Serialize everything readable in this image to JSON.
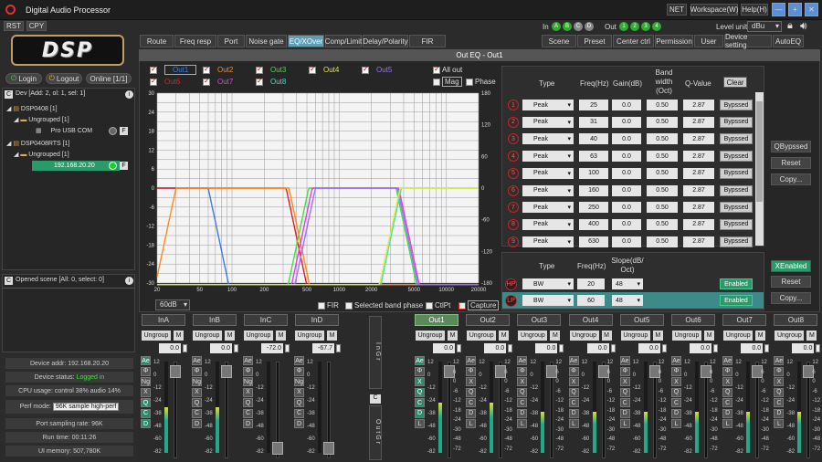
{
  "app": {
    "title": "Digital Audio Processor"
  },
  "window_buttons": {
    "net": "NET",
    "workspace": "Workspace(W)",
    "help": "Help(H)",
    "min": "—",
    "max": "+",
    "close": "✕"
  },
  "toolbar": {
    "rst": "RST",
    "cpy": "CPY",
    "in_label": "In",
    "in_badges": [
      "A",
      "B",
      "C",
      "D"
    ],
    "out_label": "Out",
    "out_badges": [
      "1",
      "2",
      "3",
      "4"
    ],
    "level_unit_label": "Level unit",
    "level_unit_value": "dBu"
  },
  "logo": {
    "text": "DSP"
  },
  "tabs": [
    "Route",
    "Freq resp",
    "Port",
    "Noise gate",
    "EQ/XOver",
    "Comp/Limit",
    "Delay/Polarity",
    "FIR"
  ],
  "right_tabs": [
    "Scene",
    "Preset",
    "Center ctrl",
    "Permission",
    "User",
    "Device setting",
    "AutoEQ"
  ],
  "left": {
    "login": "Login",
    "logout": "Logout",
    "online": "Online [1/1]",
    "dev_header": "Dev [Add: 2, ol: 1, sel: 1]",
    "tree": {
      "dsp1": "DSP0408 [1]",
      "ungrouped1": "Ungrouped [1]",
      "usb": "Pro USB COM",
      "dsp2": "DSP0408RTS [1]",
      "ungrouped2": "Ungrouped [1]",
      "ip": "192.168.20.20"
    },
    "scene_header": "Opened scene [All: 0, select: 0]",
    "f_label": "F",
    "c_label": "C",
    "status": {
      "device_addr": "Device addr: 192.168.20.20",
      "device_status_label": "Device status:",
      "device_status_value": "Logged in",
      "cpu": "CPU usage: control 38% audio 14%",
      "perf_label": "Perf mode:",
      "perf_value": "96K sample high-perf",
      "port_rate": "Port sampling rate: 96K",
      "run_time": "Run time: 00:11:26",
      "ui_memory": "UI memory: 507,780K"
    }
  },
  "eq": {
    "title": "Out EQ - Out1",
    "legend": [
      {
        "label": "Out1",
        "color": "#3c7de0",
        "checked": true
      },
      {
        "label": "Out2",
        "color": "#ff8c1a",
        "checked": true
      },
      {
        "label": "Out3",
        "color": "#44dd44",
        "checked": true
      },
      {
        "label": "Out4",
        "color": "#e8e832",
        "checked": true
      },
      {
        "label": "Out5",
        "color": "#9a70ff",
        "checked": true
      },
      {
        "label": "Out6",
        "color": "#e02020",
        "checked": true
      },
      {
        "label": "Out7",
        "color": "#e040e0",
        "checked": true
      },
      {
        "label": "Out8",
        "color": "#40e0c0",
        "checked": true
      }
    ],
    "all_out": "All out",
    "mag": "Mag",
    "phase": "Phase",
    "y_left": [
      "30",
      "24",
      "18",
      "12",
      "6",
      "0",
      "-6",
      "-12",
      "-18",
      "-24",
      "-30"
    ],
    "y_right": [
      "180",
      "120",
      "60",
      "0",
      "-60",
      "-120",
      "-180"
    ],
    "x_ticks": [
      "20",
      "50",
      "100",
      "200",
      "500",
      "1000",
      "2000",
      "5000",
      "10000",
      "20000"
    ],
    "range_select": "60dB",
    "bottom_opts": {
      "fir": "FIR",
      "selected_band_phase": "Selected band phase",
      "ctlpt": "CtlPt",
      "capture": "Capture"
    },
    "table_headers": {
      "type": "Type",
      "freq": "Freq(Hz)",
      "gain": "Gain(dB)",
      "bw": "Band width (Oct)",
      "q": "Q-Value",
      "clear": "Clear"
    },
    "bands": [
      {
        "n": "1",
        "type": "Peak",
        "freq": "25",
        "gain": "0.0",
        "bw": "0.50",
        "q": "2.87",
        "state": "Bypssed"
      },
      {
        "n": "2",
        "type": "Peak",
        "freq": "31",
        "gain": "0.0",
        "bw": "0.50",
        "q": "2.87",
        "state": "Bypssed"
      },
      {
        "n": "3",
        "type": "Peak",
        "freq": "40",
        "gain": "0.0",
        "bw": "0.50",
        "q": "2.87",
        "state": "Bypssed"
      },
      {
        "n": "4",
        "type": "Peak",
        "freq": "63",
        "gain": "0.0",
        "bw": "0.50",
        "q": "2.87",
        "state": "Bypssed"
      },
      {
        "n": "5",
        "type": "Peak",
        "freq": "100",
        "gain": "0.0",
        "bw": "0.50",
        "q": "2.87",
        "state": "Bypssed"
      },
      {
        "n": "6",
        "type": "Peak",
        "freq": "160",
        "gain": "0.0",
        "bw": "0.50",
        "q": "2.87",
        "state": "Bypssed"
      },
      {
        "n": "7",
        "type": "Peak",
        "freq": "250",
        "gain": "0.0",
        "bw": "0.50",
        "q": "2.87",
        "state": "Bypssed"
      },
      {
        "n": "8",
        "type": "Peak",
        "freq": "400",
        "gain": "0.0",
        "bw": "0.50",
        "q": "2.87",
        "state": "Bypssed"
      },
      {
        "n": "9",
        "type": "Peak",
        "freq": "630",
        "gain": "0.0",
        "bw": "0.50",
        "q": "2.87",
        "state": "Bypssed"
      }
    ],
    "side_btns": {
      "qbypassed": "QBypssed",
      "reset": "Reset",
      "copy": "Copy..."
    },
    "xover_headers": {
      "type": "Type",
      "freq": "Freq(Hz)",
      "slope": "Slope(dB/ Oct)"
    },
    "xover": [
      {
        "tag": "HP",
        "type": "BW",
        "freq": "20",
        "slope": "48",
        "state": "Enabled"
      },
      {
        "tag": "LP",
        "type": "BW",
        "freq": "60",
        "slope": "48",
        "state": "Enabled"
      }
    ],
    "xover_side": {
      "xenabled": "XEnabled",
      "reset": "Reset",
      "copy": "Copy..."
    }
  },
  "mixer": {
    "in_channels": [
      {
        "name": "InA",
        "group": "Ungroup",
        "value": "0.0"
      },
      {
        "name": "InB",
        "group": "Ungroup",
        "value": "0.0"
      },
      {
        "name": "InC",
        "group": "Ungroup",
        "value": "-72.0"
      },
      {
        "name": "InD",
        "group": "Ungroup",
        "value": "-67.7"
      }
    ],
    "out_channels": [
      {
        "name": "Out1",
        "group": "Ungroup",
        "value": "0.0",
        "active": true
      },
      {
        "name": "Out2",
        "group": "Ungroup",
        "value": "0.0"
      },
      {
        "name": "Out3",
        "group": "Ungroup",
        "value": "0.0"
      },
      {
        "name": "Out4",
        "group": "Ungroup",
        "value": "0.0"
      },
      {
        "name": "Out5",
        "group": "Ungroup",
        "value": "0.0"
      },
      {
        "name": "Out6",
        "group": "Ungroup",
        "value": "0.0"
      },
      {
        "name": "Out7",
        "group": "Ungroup",
        "value": "0.0"
      },
      {
        "name": "Out8",
        "group": "Ungroup",
        "value": "0.0"
      }
    ],
    "m_label": "M",
    "in_strip_btns": [
      "Ae",
      "Φ",
      "Ng",
      "X",
      "Q",
      "C",
      "D"
    ],
    "out_strip_btns": [
      "Ae",
      "Φ",
      "X",
      "Q",
      "C",
      "D",
      "L"
    ],
    "scale": [
      "12",
      "0",
      "-12",
      "-24",
      "-38",
      "-48",
      "-60",
      "-82"
    ],
    "scale_right": [
      "12",
      "6",
      "0",
      "-6",
      "-12",
      "-18",
      "-24",
      "-30",
      "-48",
      "-72"
    ],
    "in_grp": "InGr",
    "out_grp": "OutGr",
    "c_label": "C"
  }
}
